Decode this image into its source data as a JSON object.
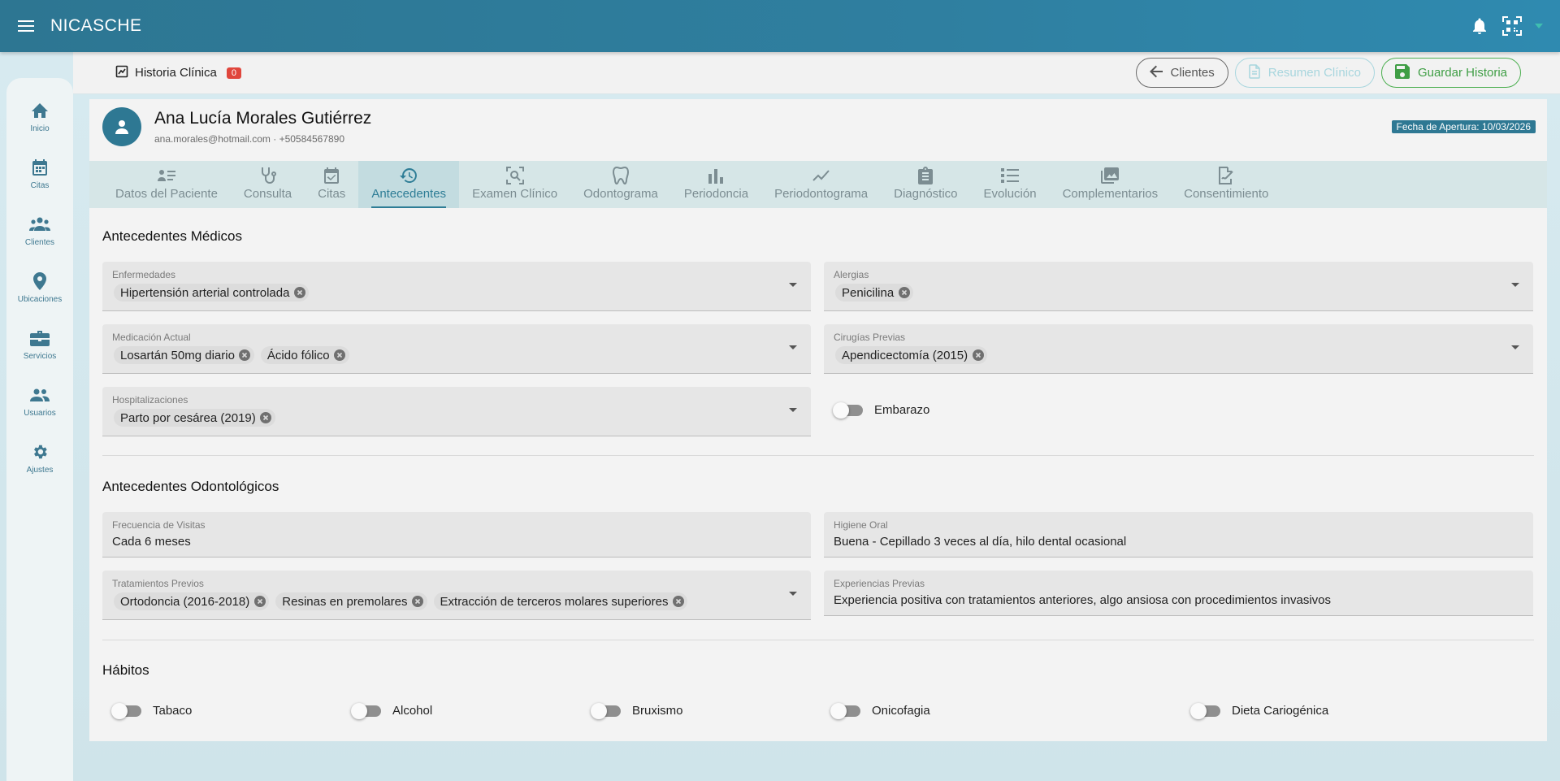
{
  "app": {
    "title": "NICASCHE"
  },
  "sidebar": {
    "items": [
      {
        "label": "Inicio",
        "icon": "home-icon"
      },
      {
        "label": "Citas",
        "icon": "calendar-icon"
      },
      {
        "label": "Clientes",
        "icon": "group-icon"
      },
      {
        "label": "Ubicaciones",
        "icon": "location-icon"
      },
      {
        "label": "Servicios",
        "icon": "toolbox-icon"
      },
      {
        "label": "Usuarios",
        "icon": "users-icon"
      },
      {
        "label": "Ajustes",
        "icon": "gear-icon"
      }
    ]
  },
  "header": {
    "title": "Historia Clínica",
    "badge": "0",
    "buttons": {
      "clientes": "Clientes",
      "resumen": "Resumen Clínico",
      "guardar": "Guardar Historia"
    }
  },
  "patient": {
    "name": "Ana Lucía Morales Gutiérrez",
    "contact": "ana.morales@hotmail.com · +50584567890",
    "fecha": "Fecha de Apertura: 10/03/2026"
  },
  "tabs": [
    {
      "label": "Datos del Paciente",
      "icon": "person-list-icon"
    },
    {
      "label": "Consulta",
      "icon": "stethoscope-icon"
    },
    {
      "label": "Citas",
      "icon": "calendar-check-icon"
    },
    {
      "label": "Antecedentes",
      "icon": "history-icon",
      "active": true
    },
    {
      "label": "Examen Clínico",
      "icon": "scan-icon"
    },
    {
      "label": "Odontograma",
      "icon": "tooth-icon"
    },
    {
      "label": "Periodoncia",
      "icon": "bar-chart-icon"
    },
    {
      "label": "Periodontograma",
      "icon": "trend-icon"
    },
    {
      "label": "Diagnóstico",
      "icon": "clipboard-icon"
    },
    {
      "label": "Evolución",
      "icon": "list-numbered-icon"
    },
    {
      "label": "Complementarios",
      "icon": "images-icon"
    },
    {
      "label": "Consentimiento",
      "icon": "signature-icon"
    }
  ],
  "medicos": {
    "title": "Antecedentes Médicos",
    "enfermedades": {
      "label": "Enfermedades",
      "chips": [
        "Hipertensión arterial controlada"
      ]
    },
    "alergias": {
      "label": "Alergias",
      "chips": [
        "Penicilina"
      ]
    },
    "medicacion": {
      "label": "Medicación Actual",
      "chips": [
        "Losartán 50mg diario",
        "Ácido fólico"
      ]
    },
    "cirugias": {
      "label": "Cirugías Previas",
      "chips": [
        "Apendicectomía (2015)"
      ]
    },
    "hospitalizaciones": {
      "label": "Hospitalizaciones",
      "chips": [
        "Parto por cesárea (2019)"
      ]
    },
    "embarazo": "Embarazo"
  },
  "odonto": {
    "title": "Antecedentes Odontológicos",
    "frecuencia": {
      "label": "Frecuencia de Visitas",
      "value": "Cada 6 meses"
    },
    "higiene": {
      "label": "Higiene Oral",
      "value": "Buena - Cepillado 3 veces al día, hilo dental ocasional"
    },
    "tratamientos": {
      "label": "Tratamientos Previos",
      "chips": [
        "Ortodoncia (2016-2018)",
        "Resinas en premolares",
        "Extracción de terceros molares superiores"
      ]
    },
    "experiencias": {
      "label": "Experiencias Previas",
      "value": "Experiencia positiva con tratamientos anteriores, algo ansiosa con procedimientos invasivos"
    }
  },
  "habitos": {
    "title": "Hábitos",
    "items": [
      "Tabaco",
      "Alcohol",
      "Bruxismo",
      "Onicofagia",
      "Dieta Cariogénica"
    ]
  },
  "colors": {
    "primary": "#2e7893",
    "topbar": "#2f7fa0",
    "green": "#4caf50",
    "badge": "#e0463c"
  }
}
